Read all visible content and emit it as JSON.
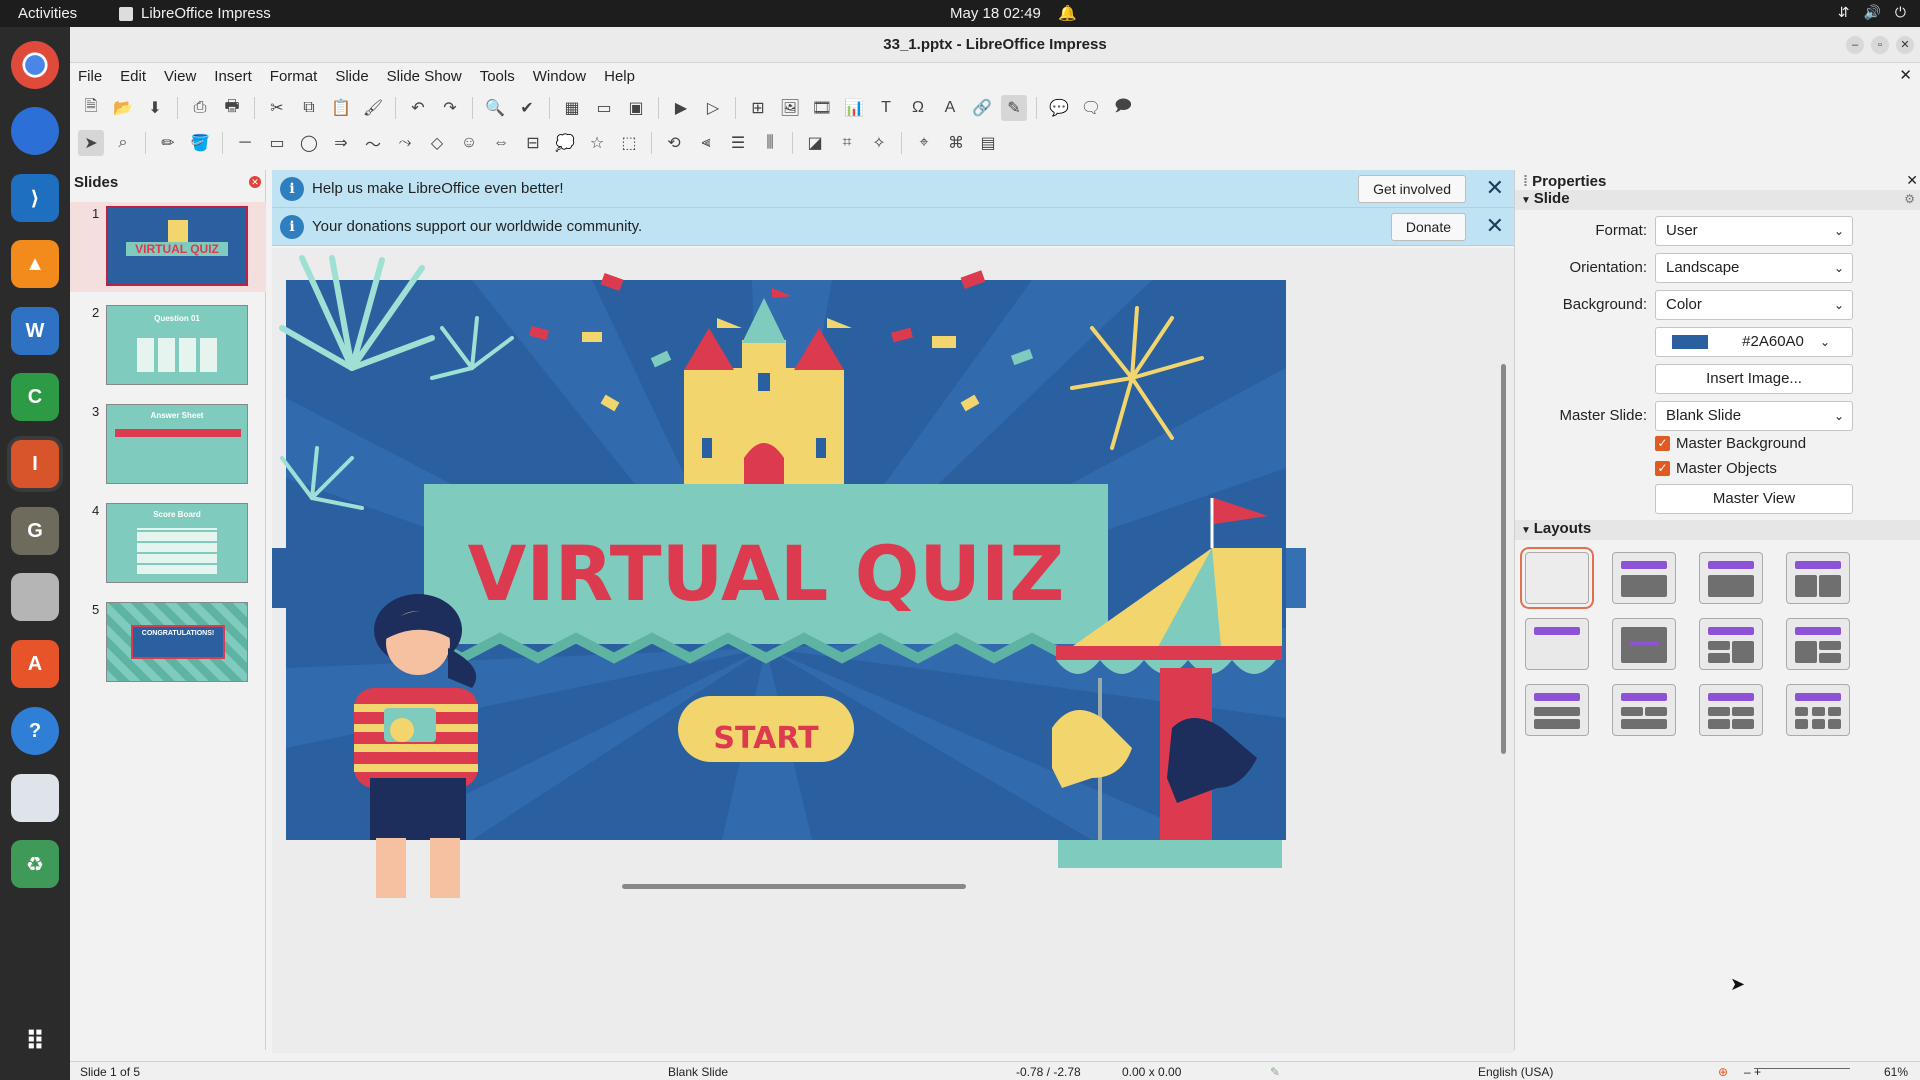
{
  "topbar": {
    "activities": "Activities",
    "app_name": "LibreOffice Impress",
    "clock": "May 18  02:49"
  },
  "window": {
    "title": "33_1.pptx - LibreOffice Impress"
  },
  "menu": [
    "File",
    "Edit",
    "View",
    "Insert",
    "Format",
    "Slide",
    "Slide Show",
    "Tools",
    "Window",
    "Help"
  ],
  "slides_pane": {
    "title": "Slides",
    "slides": [
      {
        "num": "1",
        "title": "VIRTUAL QUIZ"
      },
      {
        "num": "2",
        "title": "Question 01"
      },
      {
        "num": "3",
        "title": "Answer Sheet"
      },
      {
        "num": "4",
        "title": "Score Board"
      },
      {
        "num": "5",
        "title": "CONGRATULATIONS!"
      }
    ]
  },
  "infobars": [
    {
      "text": "Help us make LibreOffice even better!",
      "button": "Get involved"
    },
    {
      "text": "Your donations support our worldwide community.",
      "button": "Donate"
    }
  ],
  "slide": {
    "title": "VIRTUAL QUIZ",
    "button": "START",
    "background_color": "#2A60A0"
  },
  "properties": {
    "title": "Properties",
    "section": "Slide",
    "format_label": "Format:",
    "format_value": "User",
    "orientation_label": "Orientation:",
    "orientation_value": "Landscape",
    "background_label": "Background:",
    "background_value": "Color",
    "color_value": "#2A60A0",
    "insert_image": "Insert Image...",
    "master_slide_label": "Master Slide:",
    "master_slide_value": "Blank Slide",
    "master_background": "Master Background",
    "master_objects": "Master Objects",
    "master_view": "Master View",
    "layouts_title": "Layouts"
  },
  "statusbar": {
    "slide_pos": "Slide 1 of 5",
    "master": "Blank Slide",
    "coords": "-0.78 / -2.78",
    "size": "0.00 x 0.00",
    "language": "English (USA)",
    "zoom": "61%"
  },
  "colors": {
    "accent": "#e05a22",
    "slide_bg": "#2A60A0",
    "title_red": "#dc3a4e",
    "mint": "#7fcbbd",
    "yellow": "#f3d56e"
  }
}
